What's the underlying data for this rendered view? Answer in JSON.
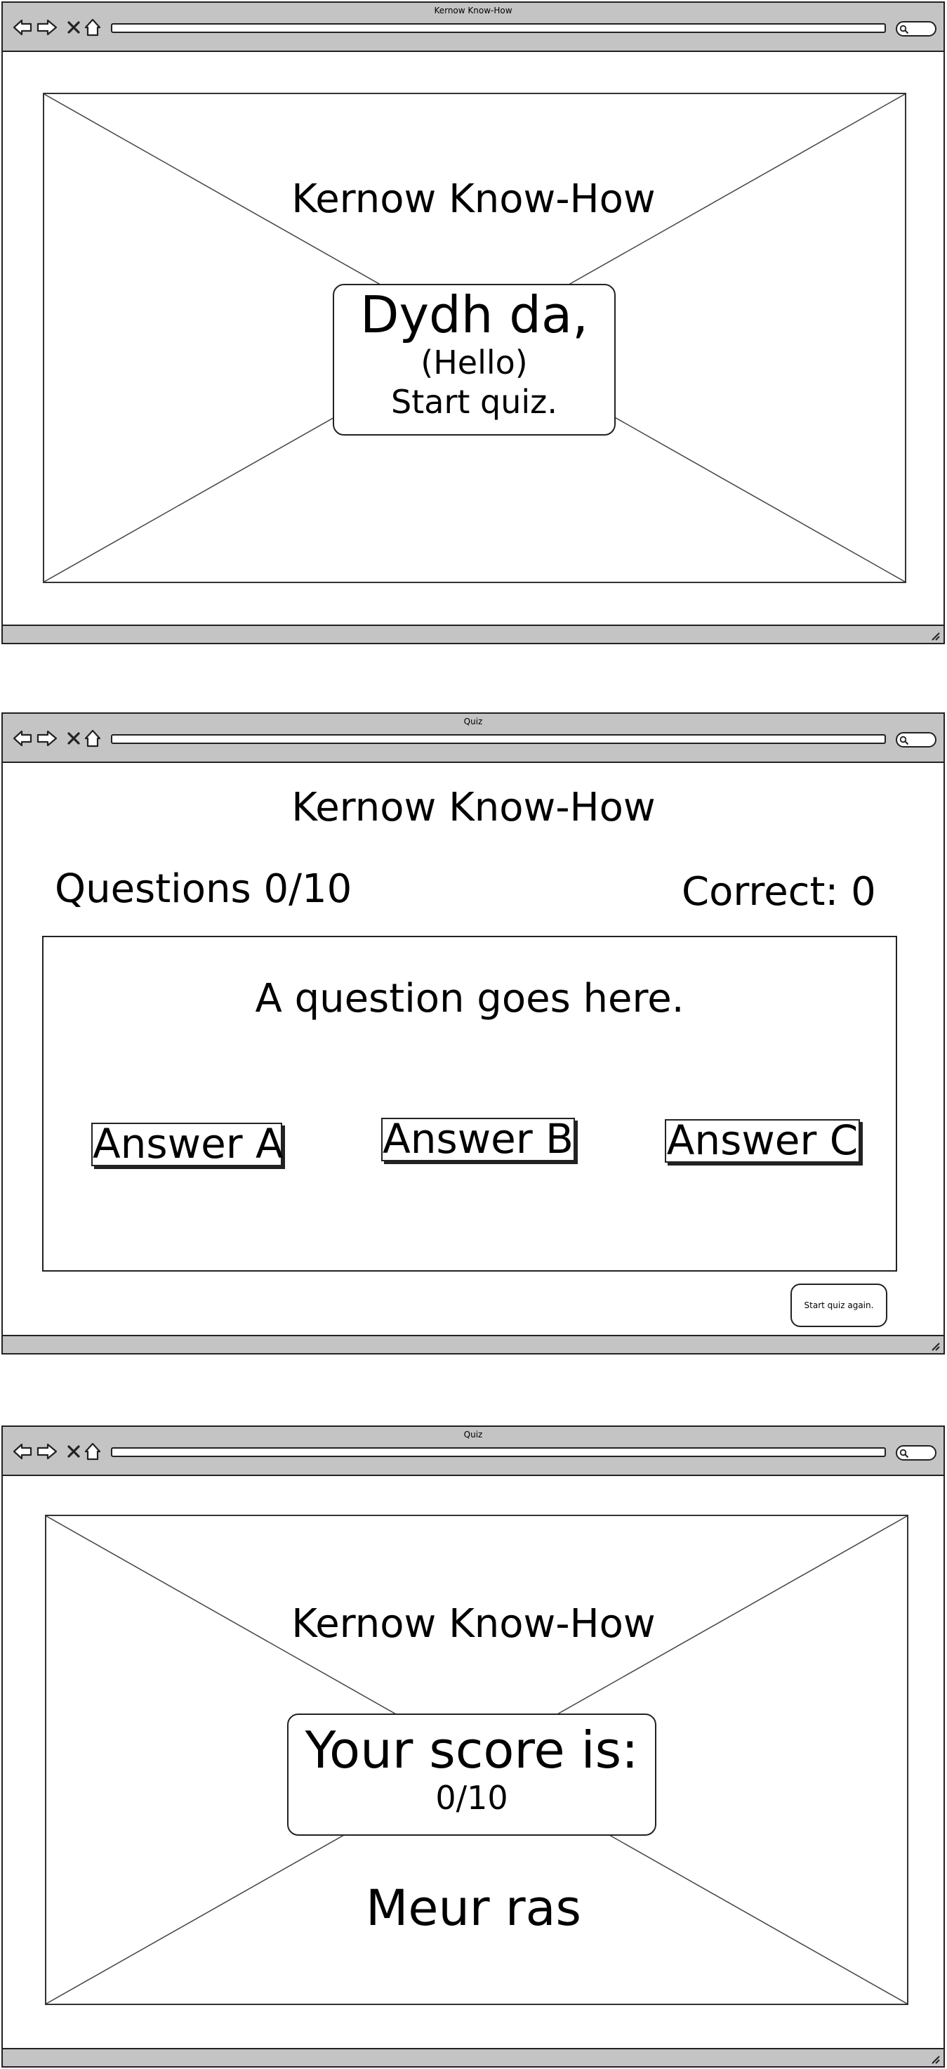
{
  "windows": [
    {
      "title": "Kernow Know-How"
    },
    {
      "title": "Quiz"
    },
    {
      "title": "Quiz"
    }
  ],
  "start_screen": {
    "heading": "Kernow Know-How",
    "greeting": "Dydh da,",
    "greeting_translation": "(Hello)",
    "start_label": "Start quiz."
  },
  "quiz_screen": {
    "heading": "Kernow Know-How",
    "questions_counter": "Questions 0/10",
    "correct_counter": "Correct: 0",
    "question": "A question goes here.",
    "answers": [
      "Answer A",
      "Answer B",
      "Answer C"
    ],
    "restart_label": "Start quiz again."
  },
  "score_screen": {
    "heading": "Kernow Know-How",
    "score_label": "Your score is:",
    "score_value": "0/10",
    "farewell": "Meur ras"
  },
  "icons": [
    "back-arrow-icon",
    "forward-arrow-icon",
    "close-icon",
    "home-icon",
    "search-icon",
    "resize-grip-icon"
  ],
  "colors": {
    "chrome": "#c4c4c4",
    "stroke": "#222222",
    "background": "#ffffff"
  }
}
